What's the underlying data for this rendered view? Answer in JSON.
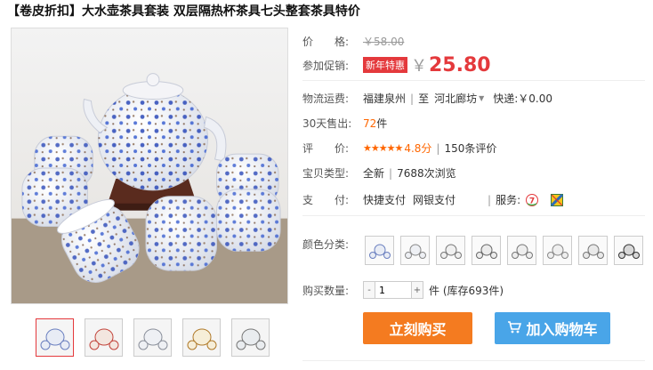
{
  "product": {
    "title": "【卷皮折扣】大水壶茶具套装 双层隔热杯茶具七头整套茶具特价"
  },
  "price": {
    "label": "价　　格:",
    "original": "￥58.00"
  },
  "promo": {
    "label": "参加促销:",
    "tag": "新年特惠",
    "currency": "￥",
    "price": "25.80"
  },
  "shipping": {
    "label": "物流运费:",
    "from": "福建泉州",
    "to_word": "至",
    "to": "河北廊坊",
    "express": "快递:￥0.00"
  },
  "sales": {
    "label": "30天售出:",
    "count": "72",
    "unit": "件"
  },
  "rating": {
    "label": "评　　价:",
    "stars": "★★★★★",
    "score": "4.8分",
    "reviews": "150条评价"
  },
  "type": {
    "label": "宝贝类型:",
    "value": "全新",
    "views": "7688次浏览"
  },
  "payment": {
    "label": "支　　付:",
    "methods": [
      "快捷支付",
      "网银支付"
    ],
    "service_label": "服务:"
  },
  "colors": {
    "label": "颜色分类:"
  },
  "quantity": {
    "label": "购买数量:",
    "value": "1",
    "minus": "-",
    "plus": "+",
    "stock": "件 (库存693件)"
  },
  "buttons": {
    "buy_now": "立刻购买",
    "add_cart": "加入购物车"
  },
  "accent_colors": {
    "price_red": "#e4393c",
    "buy_orange": "#f47b20",
    "cart_blue": "#49a5e8"
  }
}
